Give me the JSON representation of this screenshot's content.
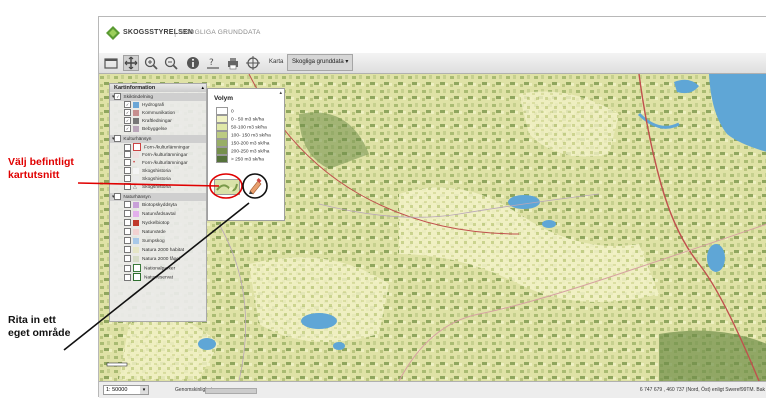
{
  "header": {
    "brand": "SKOGSSTYRELSEN",
    "subtitle": "SKOGLIGA GRUNDDATA"
  },
  "toolbar": {
    "karta_label": "Karta",
    "layer_dropdown": "Skogliga grunddata ▾"
  },
  "layer_panel": {
    "title": "Kartinformation",
    "groups": [
      {
        "label": "Skiktindelning",
        "checked": true,
        "items": [
          {
            "label": "Hydrografi",
            "checked": true
          },
          {
            "label": "Kommunikation",
            "checked": true
          },
          {
            "label": "Kraftledningar",
            "checked": true
          },
          {
            "label": "Bebyggelse",
            "checked": true
          }
        ]
      },
      {
        "label": "Kulturhänsyn",
        "checked": false,
        "items": [
          {
            "label": "Forn-/kulturlämningar",
            "checked": false
          },
          {
            "label": "Forn-/kulturlämningar",
            "checked": false
          },
          {
            "label": "Forn-/kulturlämningar",
            "checked": false
          },
          {
            "label": "Skogshistoria",
            "checked": false
          },
          {
            "label": "Skogshistoria",
            "checked": false
          },
          {
            "label": "Skogshistoria",
            "checked": false
          }
        ]
      },
      {
        "label": "Naturhänsyn",
        "checked": false,
        "items": [
          {
            "label": "Biotopskyddsyta",
            "checked": false
          },
          {
            "label": "Naturvårdsavtal",
            "checked": false
          },
          {
            "label": "Nyckelbiotop",
            "checked": false
          },
          {
            "label": "Naturvärde",
            "checked": false
          },
          {
            "label": "Sumpskog",
            "checked": false
          },
          {
            "label": "Natura 2000 habitat",
            "checked": false
          },
          {
            "label": "Natura 2000 fågel",
            "checked": false
          },
          {
            "label": "Nationalparker",
            "checked": false
          },
          {
            "label": "Naturreservat",
            "checked": false
          }
        ]
      }
    ]
  },
  "legend": {
    "title": "Volym",
    "items": [
      {
        "label": "0",
        "color": "#ffffff"
      },
      {
        "label": "0 - 50 m3 sk/ha",
        "color": "#f1f3c4"
      },
      {
        "label": "50-100 m3 sk/ha",
        "color": "#e0e8a8"
      },
      {
        "label": "100- 150 m3 sk/ha",
        "color": "#bccb82"
      },
      {
        "label": "150-200 m3 sk/ha",
        "color": "#98ae66"
      },
      {
        "label": "200-250 m3 sk/ha",
        "color": "#76904c"
      },
      {
        "label": "> 250 m3 sk/ha",
        "color": "#55723a"
      }
    ]
  },
  "statusbar": {
    "scale": "1: 50000",
    "opacity_label": "Genomskinlighet:",
    "coordinates": "6 747 679 , 460 737 (Nord, Öst) enligt Sweref99TM. Bak"
  },
  "annotations": {
    "red_text": "Välj befintligt kartutsnitt",
    "black_text": "Rita in ett eget område"
  },
  "colors": {
    "annotation_red": "#e00000",
    "water": "#5fa6d6",
    "road": "#c0504d"
  }
}
